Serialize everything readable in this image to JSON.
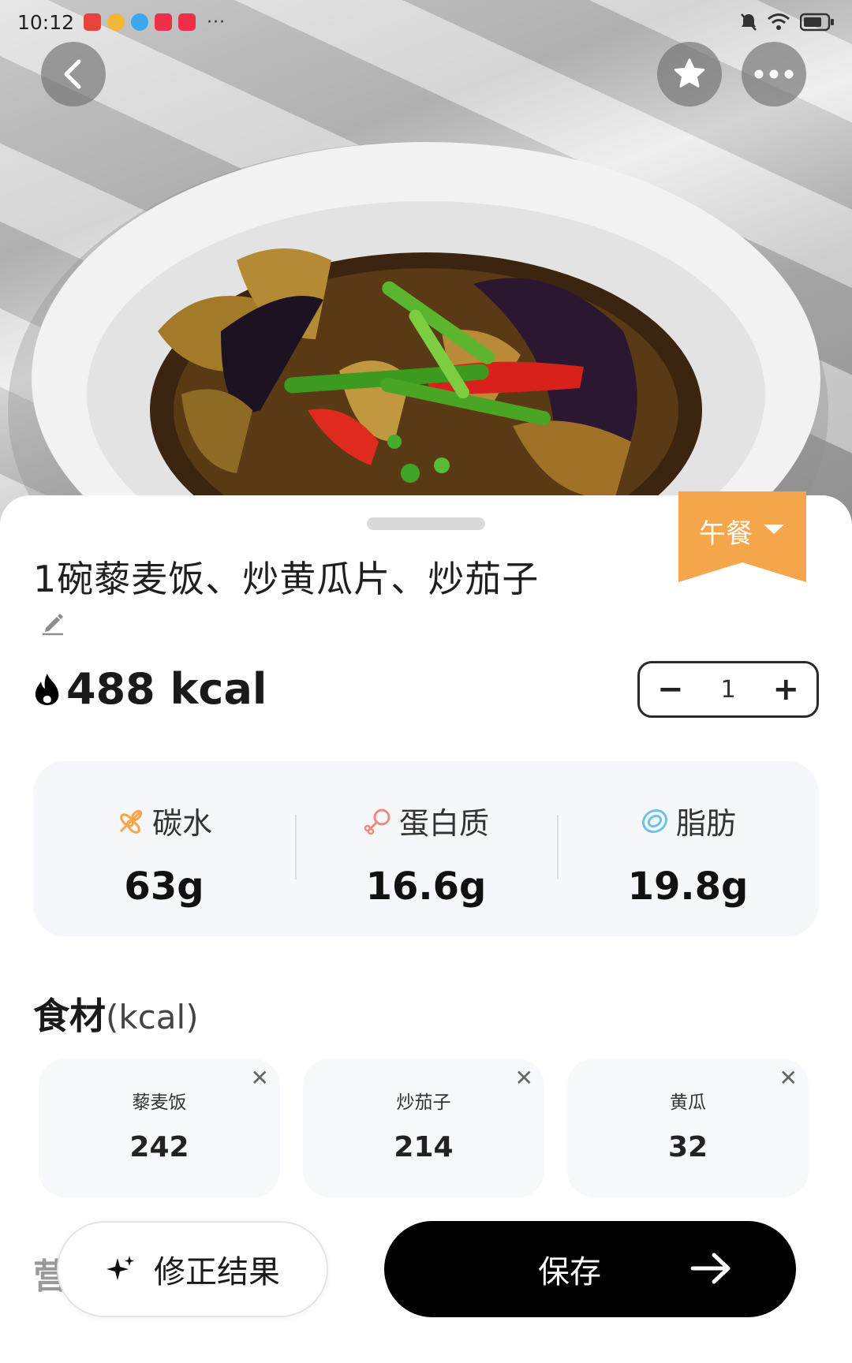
{
  "status_bar": {
    "time": "10:12"
  },
  "meal": {
    "type_label": "午餐"
  },
  "dish": {
    "title": "1碗藜麦饭、炒黄瓜片、炒茄子",
    "calories": "488 kcal"
  },
  "portion": {
    "quantity": "1",
    "minus": "−",
    "plus": "+"
  },
  "macros": [
    {
      "label": "碳水",
      "value": "63g"
    },
    {
      "label": "蛋白质",
      "value": "16.6g"
    },
    {
      "label": "脂肪",
      "value": "19.8g"
    }
  ],
  "ingredients_section": {
    "title": "食材",
    "unit": "(kcal)"
  },
  "ingredients": [
    {
      "name": "藜麦饭",
      "kcal": "242"
    },
    {
      "name": "炒茄子",
      "kcal": "214"
    },
    {
      "name": "黄瓜",
      "kcal": "32"
    }
  ],
  "partial_heading": "营",
  "actions": {
    "fix_label": "修正结果",
    "save_label": "保存"
  },
  "colors": {
    "accent": "#F5A54A",
    "primary_button": "#000000",
    "card_bg": "#F6F7FB"
  }
}
